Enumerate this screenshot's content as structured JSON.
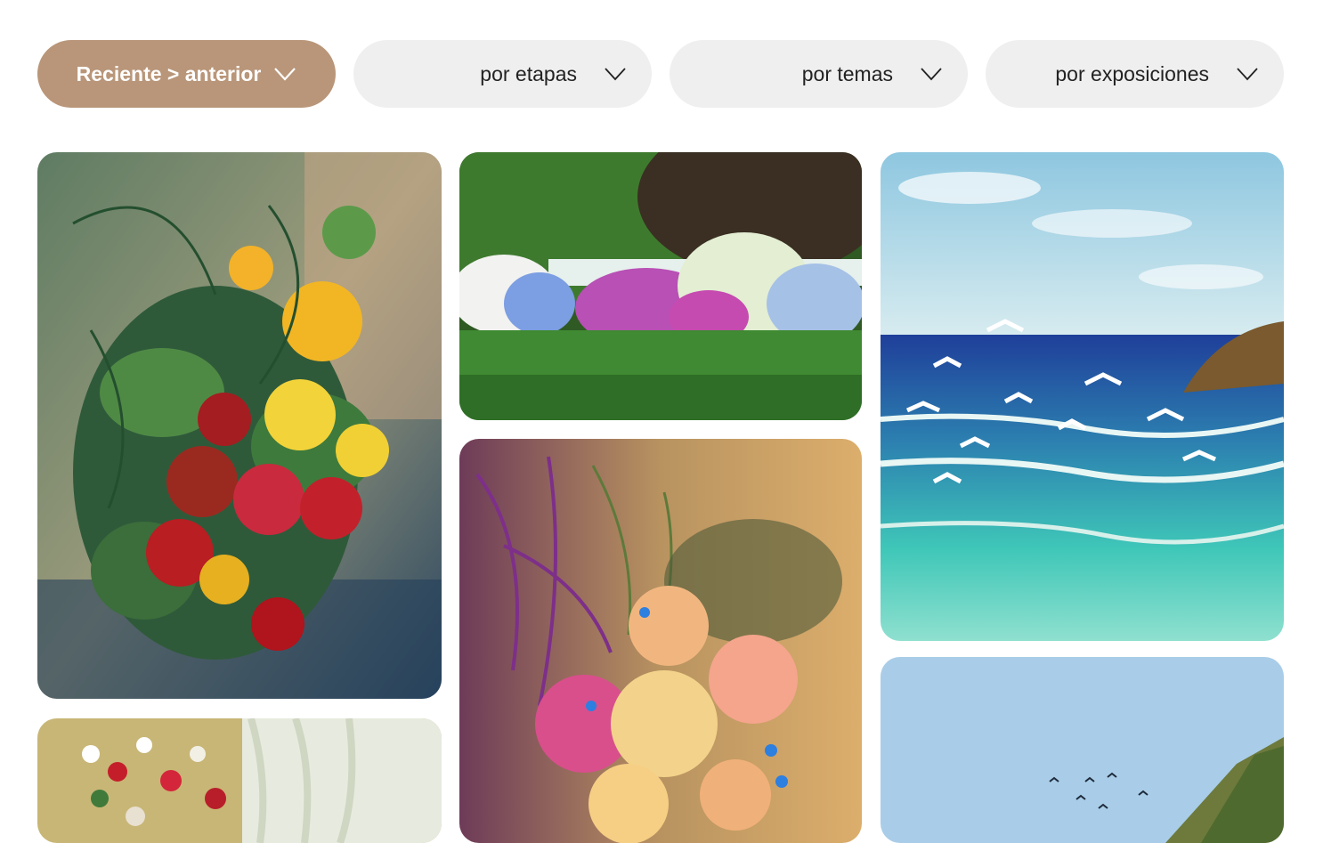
{
  "filters": [
    {
      "label": "Reciente > anterior",
      "active": true,
      "icon": "chevron-down-icon"
    },
    {
      "label": "por etapas",
      "active": false,
      "icon": "chevron-down-icon"
    },
    {
      "label": "por temas",
      "active": false,
      "icon": "chevron-down-icon"
    },
    {
      "label": "por exposiciones",
      "active": false,
      "icon": "chevron-down-icon"
    }
  ],
  "colors": {
    "accent": "#b99679",
    "filter_bg": "#efefef"
  },
  "gallery": [
    {
      "subject": "nasturtium-bouquet-painting"
    },
    {
      "subject": "hydrangea-garden-painting"
    },
    {
      "subject": "seagulls-seascape-painting"
    },
    {
      "subject": "wildflowers-curtain-painting"
    },
    {
      "subject": "roses-butterflies-painting"
    },
    {
      "subject": "coastal-cliff-birds-painting"
    }
  ]
}
